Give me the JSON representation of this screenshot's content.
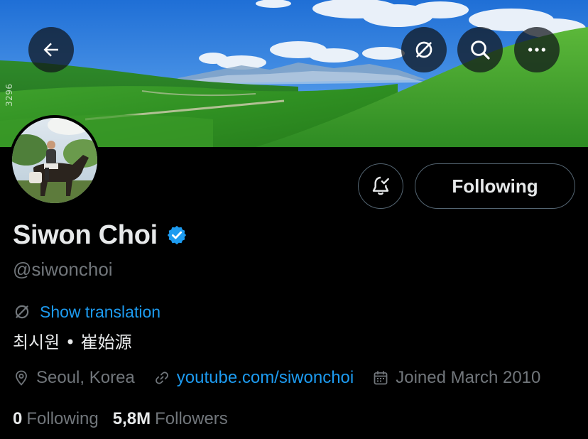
{
  "banner": {
    "watermark": "3296"
  },
  "header_buttons": {
    "back_icon": "arrow-left-icon",
    "translate_icon": "translate-icon",
    "search_icon": "search-icon",
    "more_icon": "more-icon"
  },
  "actions": {
    "notify_icon": "bell-check-icon",
    "following_label": "Following"
  },
  "profile": {
    "display_name": "Siwon Choi",
    "verified": true,
    "handle": "@siwonchoi",
    "translate_label": "Show translation",
    "bio": "최시원 • 崔始源"
  },
  "meta": {
    "location": "Seoul, Korea",
    "website": "youtube.com/siwonchoi",
    "joined": "Joined March 2010"
  },
  "counts": {
    "following_count": "0",
    "following_label": "Following",
    "followers_count": "5,8M",
    "followers_label": "Followers"
  },
  "colors": {
    "background": "#000000",
    "accent": "#1d9bf0",
    "text": "#e7e9ea",
    "muted": "#71767b",
    "border": "#536471"
  }
}
